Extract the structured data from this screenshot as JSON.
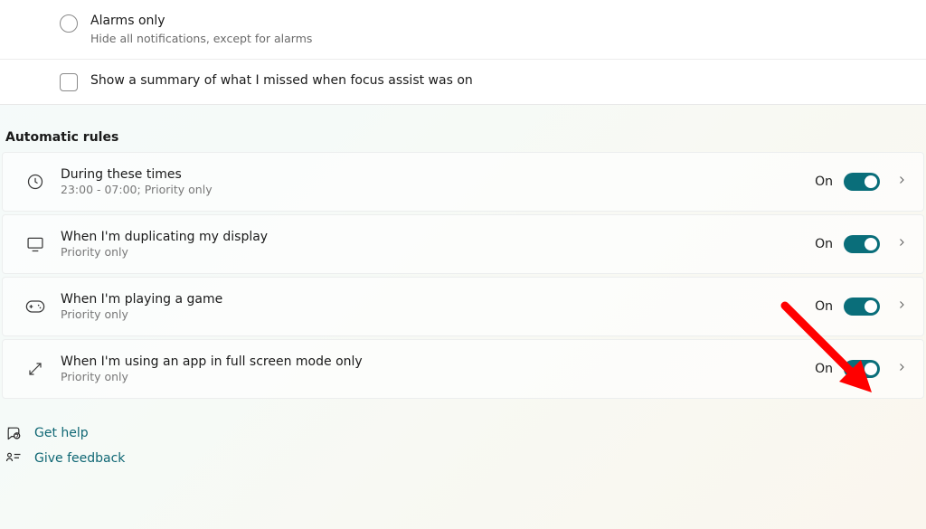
{
  "options": {
    "alarms_only": {
      "title": "Alarms only",
      "subtitle": "Hide all notifications, except for alarms"
    },
    "show_summary": {
      "label": "Show a summary of what I missed when focus assist was on"
    }
  },
  "section_header": "Automatic rules",
  "rules": [
    {
      "title": "During these times",
      "subtitle": "23:00 - 07:00; Priority only",
      "status": "On"
    },
    {
      "title": "When I'm duplicating my display",
      "subtitle": "Priority only",
      "status": "On"
    },
    {
      "title": "When I'm playing a game",
      "subtitle": "Priority only",
      "status": "On"
    },
    {
      "title": "When I'm using an app in full screen mode only",
      "subtitle": "Priority only",
      "status": "On"
    }
  ],
  "footer": {
    "get_help": "Get help",
    "give_feedback": "Give feedback"
  }
}
